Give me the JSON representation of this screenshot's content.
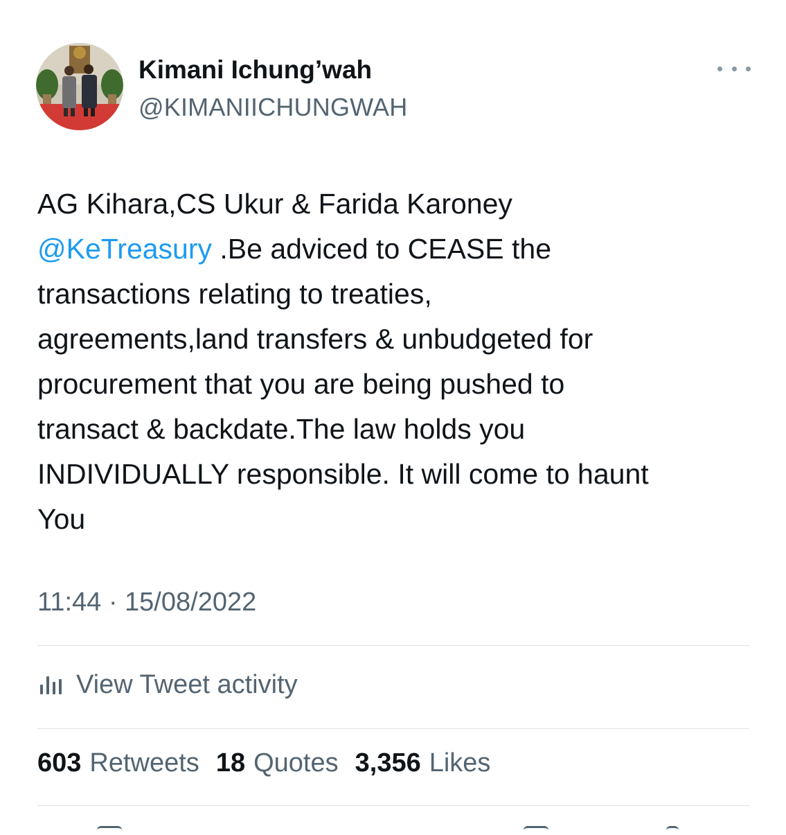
{
  "author": {
    "name": "Kimani Ichung’wah",
    "handle": "@KIMANIICHUNGWAH"
  },
  "tweet": {
    "line1": "AG Kihara,CS Ukur & Farida Karoney",
    "mention": "@KeTreasury",
    "line2_rest": " .Be adviced to CEASE the",
    "line3": "transactions relating to treaties,",
    "line4": "agreements,land transfers & unbudgeted for",
    "line5": "procurement that you are being pushed to",
    "line6": "transact & backdate.The law holds you",
    "line7": "INDIVIDUALLY responsible. It will come to haunt",
    "line8": "You"
  },
  "timestamp": "11:44 · 15/08/2022",
  "activity_label": "View Tweet activity",
  "stats": {
    "retweets_count": "603",
    "retweets_label": "Retweets",
    "quotes_count": "18",
    "quotes_label": "Quotes",
    "likes_count": "3,356",
    "likes_label": "Likes"
  },
  "icons": {
    "more": "more-options-icon",
    "activity": "bar-chart-icon"
  },
  "colors": {
    "link": "#1d9bf0",
    "text": "#0f1419",
    "secondary": "#536471",
    "divider": "#dfe3e6"
  }
}
